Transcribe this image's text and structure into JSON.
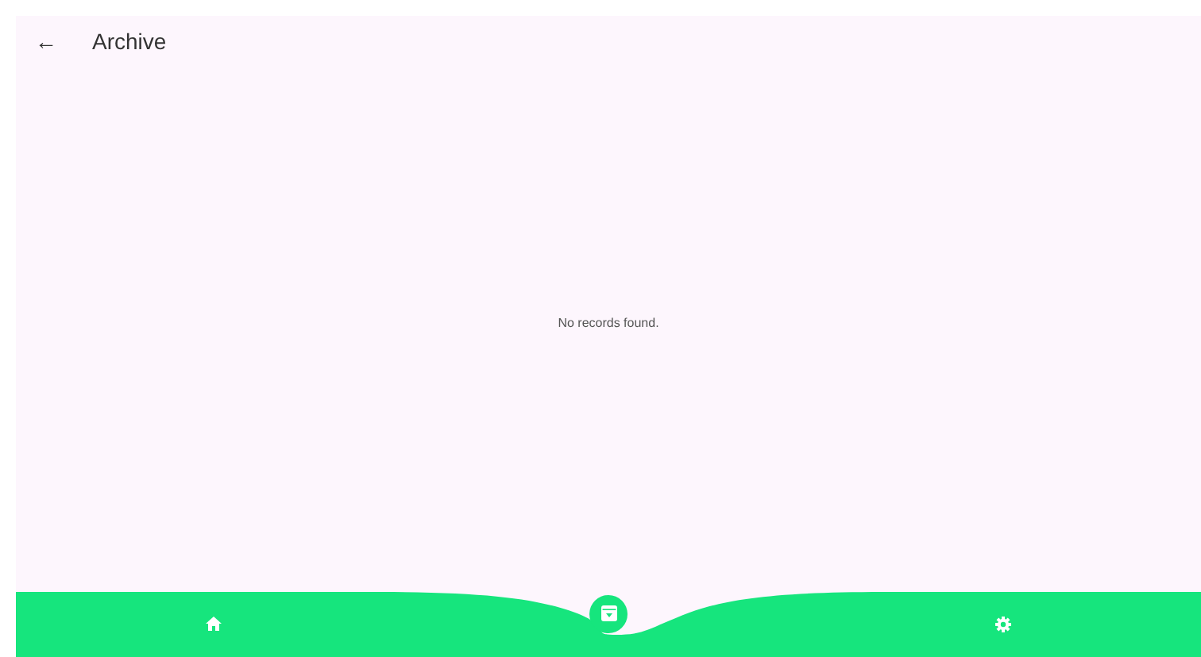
{
  "app_bar": {
    "back_glyph": "←",
    "title": "Archive"
  },
  "empty_message": "No records found.",
  "bottom_nav": [
    {
      "kind": "home",
      "selected": false
    },
    {
      "kind": "archive",
      "selected": true
    },
    {
      "kind": "settings",
      "selected": false
    }
  ]
}
